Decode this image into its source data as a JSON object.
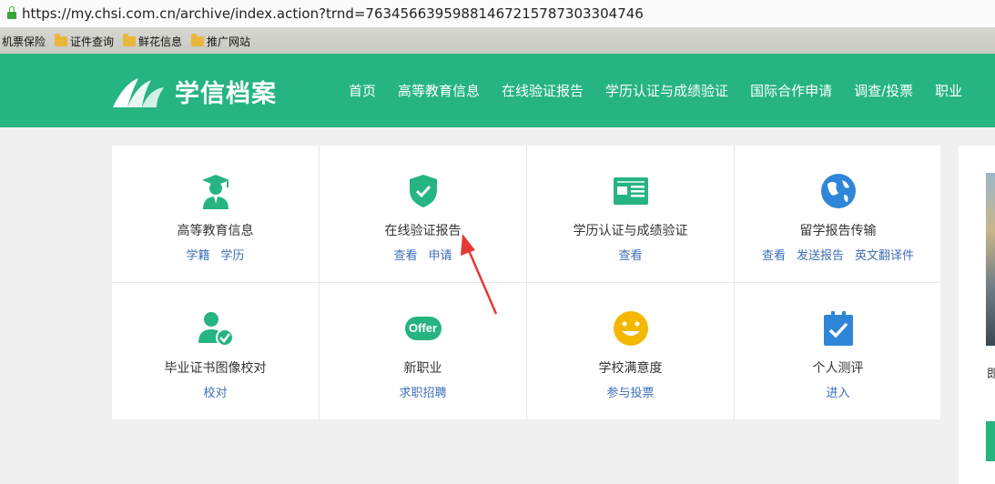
{
  "browser": {
    "url": "https://my.chsi.com.cn/archive/index.action?trnd=76345663959881467215787303304746",
    "bookmarks": [
      "机票保险",
      "证件查询",
      "鲜花信息",
      "推广网站"
    ]
  },
  "header": {
    "logo_text": "学信档案",
    "nav": [
      "首页",
      "高等教育信息",
      "在线验证报告",
      "学历认证与成绩验证",
      "国际合作申请",
      "调查/投票",
      "职业"
    ]
  },
  "cards": [
    {
      "title": "高等教育信息",
      "links": [
        "学籍",
        "学历"
      ],
      "icon": "graduate-icon"
    },
    {
      "title": "在线验证报告",
      "links": [
        "查看",
        "申请"
      ],
      "icon": "shield-check-icon"
    },
    {
      "title": "学历认证与成绩验证",
      "links": [
        "查看"
      ],
      "icon": "id-card-icon"
    },
    {
      "title": "留学报告传输",
      "links": [
        "查看",
        "发送报告",
        "英文翻译件"
      ],
      "icon": "globe-icon"
    },
    {
      "title": "毕业证书图像校对",
      "links": [
        "校对"
      ],
      "icon": "user-check-icon"
    },
    {
      "title": "新职业",
      "links": [
        "求职招聘"
      ],
      "icon": "offer-icon",
      "icon_text": "Offer"
    },
    {
      "title": "学校满意度",
      "links": [
        "参与投票"
      ],
      "icon": "smiley-icon"
    },
    {
      "title": "个人测评",
      "links": [
        "进入"
      ],
      "icon": "clipboard-check-icon"
    }
  ],
  "side": {
    "text": "即"
  },
  "colors": {
    "brand": "#26b481",
    "link": "#3d6fb6",
    "smiley": "#f5b800"
  }
}
